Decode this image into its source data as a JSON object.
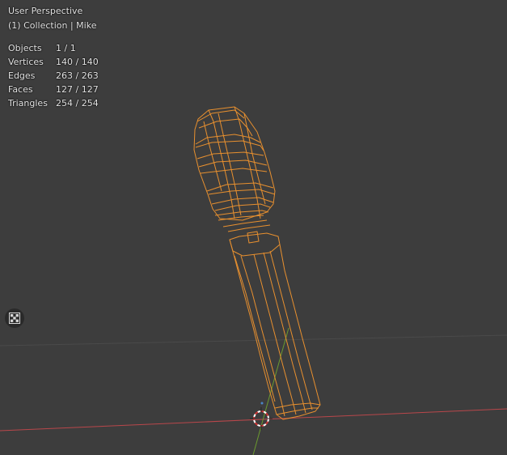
{
  "viewport": {
    "view_title": "User Perspective",
    "collection_label": "(1) Collection | Mike"
  },
  "stats": [
    {
      "label": "Objects",
      "value": "1 / 1"
    },
    {
      "label": "Vertices",
      "value": "140 / 140"
    },
    {
      "label": "Edges",
      "value": "263 / 263"
    },
    {
      "label": "Faces",
      "value": "127 / 127"
    },
    {
      "label": "Triangles",
      "value": "254 / 254"
    }
  ],
  "colors": {
    "background": "#3d3d3d",
    "selection_wire": "#e8902f",
    "x_axis": "#c0474c",
    "y_axis": "#6b9a2f",
    "grid": "#4a4a4a"
  },
  "icons": {
    "left_toolbar_button": "checkerboard-icon",
    "cursor": "3d-cursor-icon"
  }
}
